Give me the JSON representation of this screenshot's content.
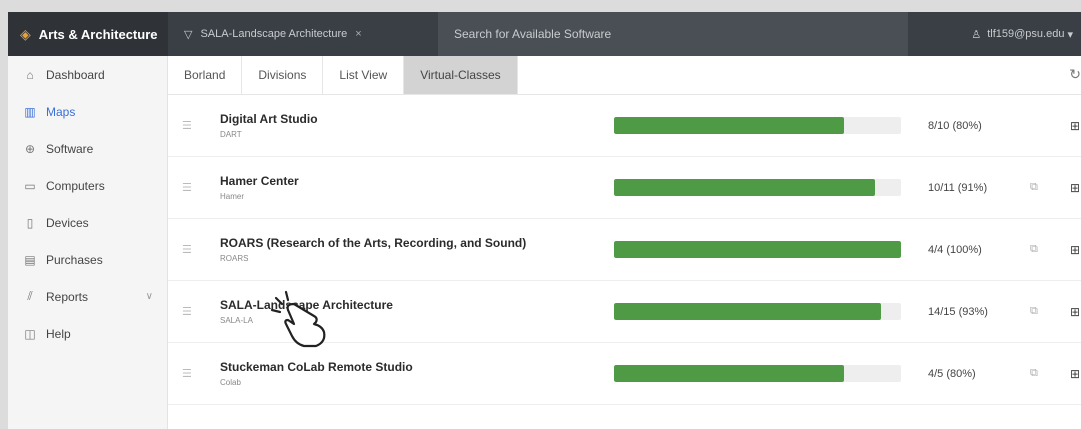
{
  "topbar": {
    "brand": "Arts & Architecture",
    "filter_label": "SALA-Landscape Architecture",
    "filter_clear": "×",
    "search_placeholder": "Search for Available Software",
    "user": "tlf159@psu.edu"
  },
  "sidebar": {
    "items": [
      {
        "label": "Dashboard",
        "icon": "home-icon"
      },
      {
        "label": "Maps",
        "icon": "map-icon",
        "active": true
      },
      {
        "label": "Software",
        "icon": "software-icon"
      },
      {
        "label": "Computers",
        "icon": "computer-icon"
      },
      {
        "label": "Devices",
        "icon": "device-icon"
      },
      {
        "label": "Purchases",
        "icon": "purchase-icon"
      },
      {
        "label": "Reports",
        "icon": "reports-icon"
      },
      {
        "label": "Help",
        "icon": "help-icon"
      }
    ]
  },
  "tabs": [
    {
      "label": "Borland"
    },
    {
      "label": "Divisions"
    },
    {
      "label": "List View"
    },
    {
      "label": "Virtual-Classes",
      "active": true
    }
  ],
  "rows": [
    {
      "name": "Digital Art Studio",
      "code": "DART",
      "usage": "8/10 (80%)",
      "fraction": 0.8
    },
    {
      "name": "Hamer Center",
      "code": "Hamer",
      "usage": "10/11 (91%)",
      "fraction": 0.91
    },
    {
      "name": "ROARS (Research of the Arts, Recording, and Sound)",
      "code": "ROARS",
      "usage": "4/4 (100%)",
      "fraction": 1.0
    },
    {
      "name": "SALA-Landscape Architecture",
      "code": "SALA-LA",
      "usage": "14/15 (93%)",
      "fraction": 0.93
    },
    {
      "name": "Stuckeman CoLab Remote Studio",
      "code": "Colab",
      "usage": "4/5 (80%)",
      "fraction": 0.8
    }
  ],
  "colors": {
    "bar_fill": "#4f9a45",
    "accent": "#3a6fd8",
    "topbar": "#3a3f45"
  }
}
